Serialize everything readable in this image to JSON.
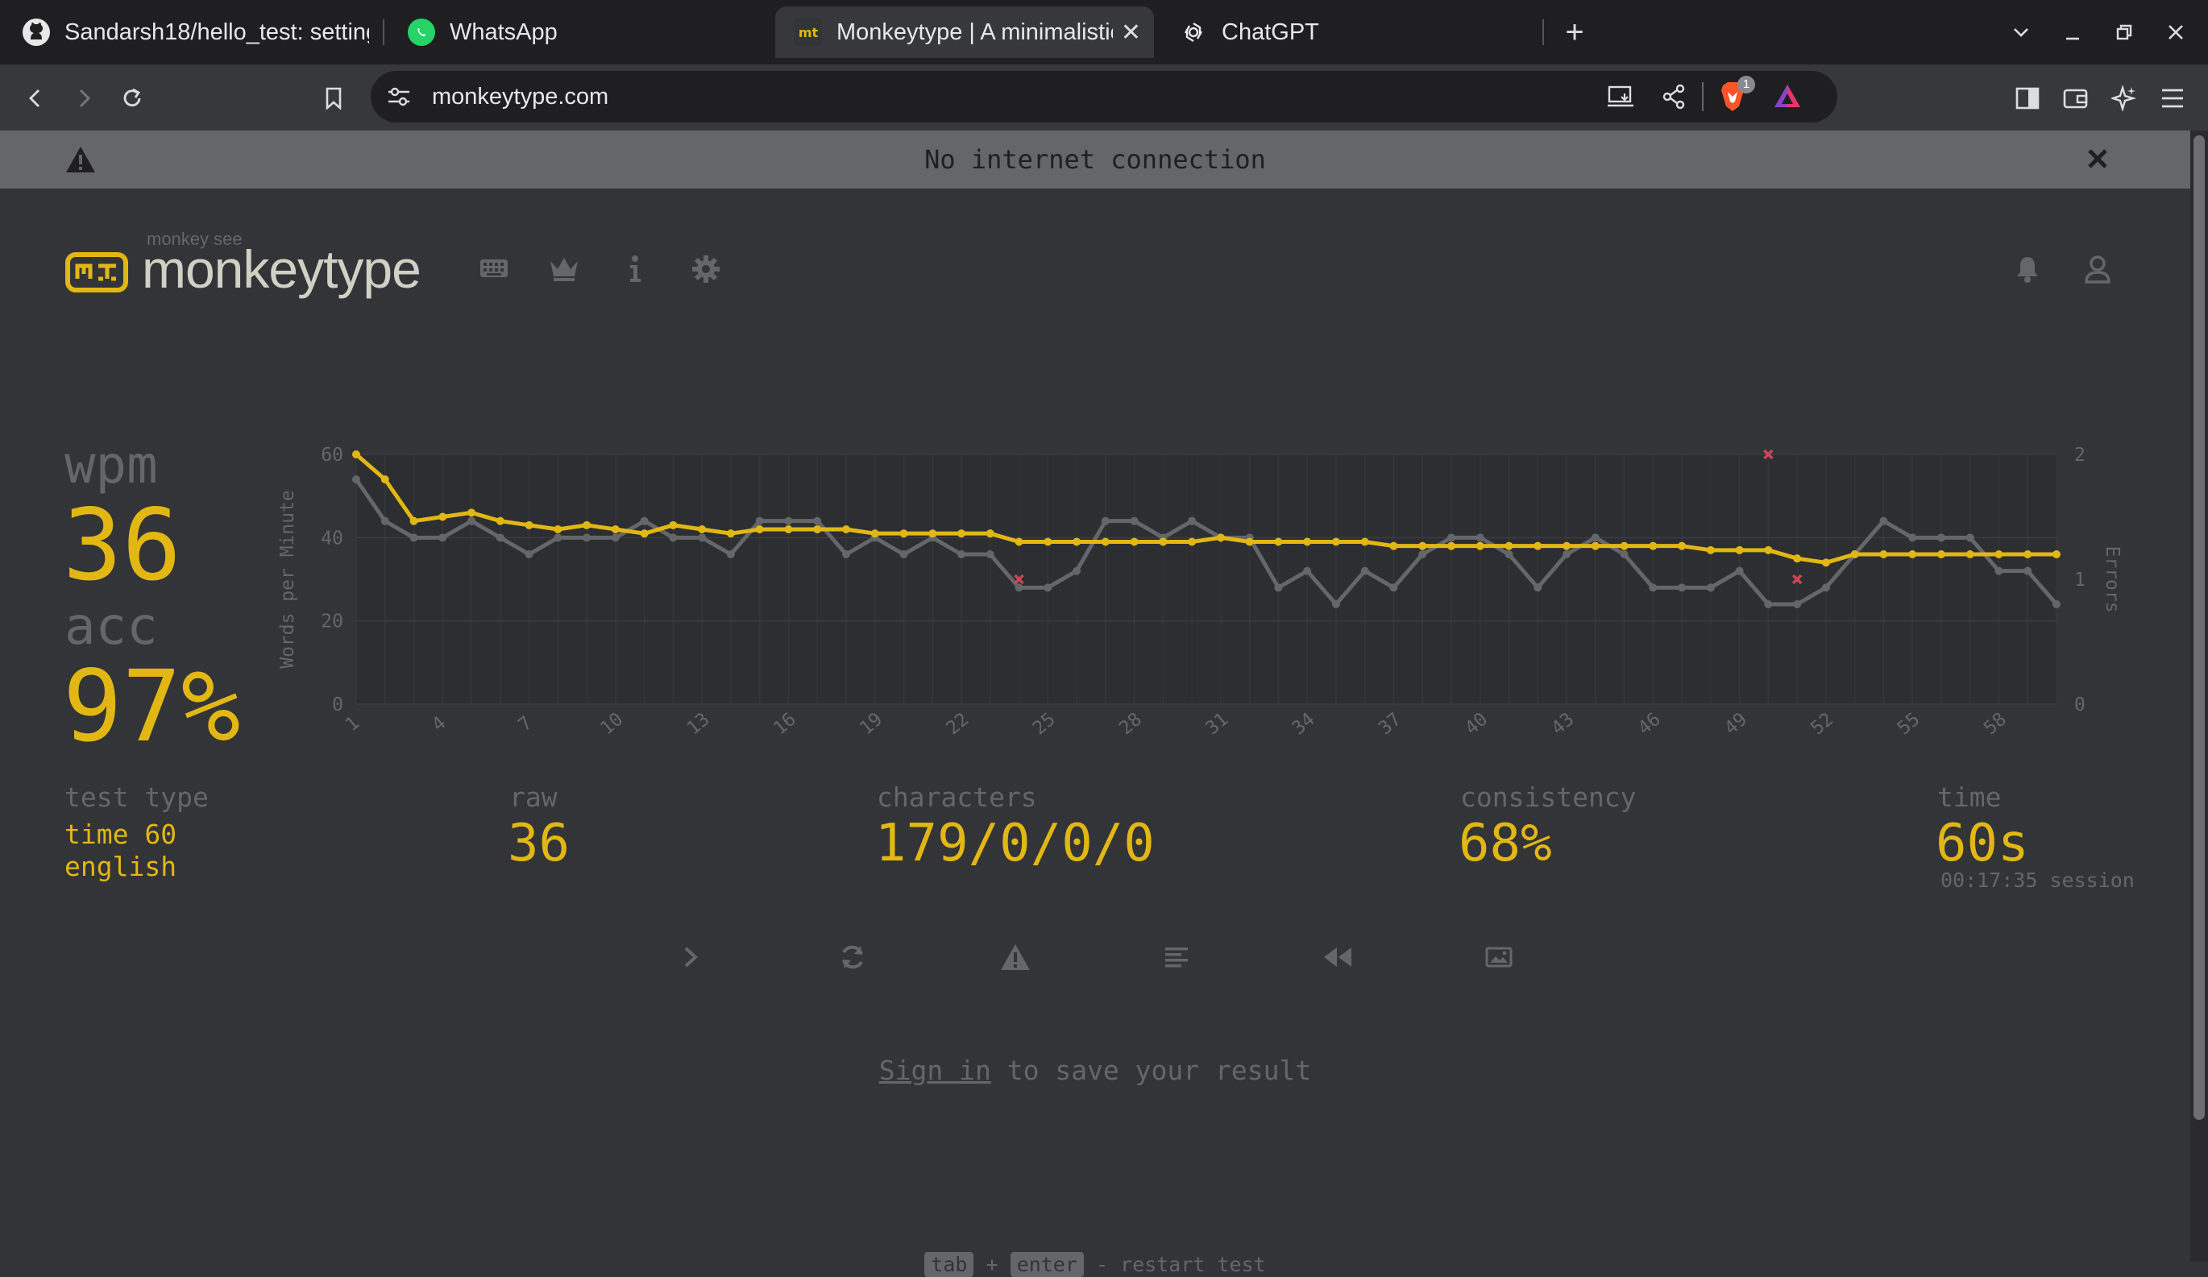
{
  "browser": {
    "tabs": [
      {
        "title": "Sandarsh18/hello_test: settings",
        "icon": "github-icon"
      },
      {
        "title": "WhatsApp",
        "icon": "whatsapp-icon"
      },
      {
        "title": "Monkeytype | A minimalistic typing test",
        "icon": "monkeytype-favicon",
        "favicon_text": "mt",
        "active": true
      },
      {
        "title": "ChatGPT",
        "icon": "chatgpt-icon"
      }
    ],
    "url": "monkeytype.com",
    "brave_badge": "1"
  },
  "banner": {
    "text": "No internet connection"
  },
  "header": {
    "logo_top": "monkey see",
    "logo_text": "monkeytype",
    "logo_mark": "mt",
    "nav_icons": [
      "keyboard-icon",
      "crown-icon",
      "info-icon",
      "settings-icon",
      "bell-icon",
      "user-icon"
    ]
  },
  "result": {
    "wpm_label": "wpm",
    "wpm": "36",
    "acc_label": "acc",
    "acc": "97%",
    "test_type_label": "test type",
    "test_type_1": "time 60",
    "test_type_2": "english",
    "raw_label": "raw",
    "raw": "36",
    "characters_label": "characters",
    "characters": "179/0/0/0",
    "consistency_label": "consistency",
    "consistency": "68%",
    "time_label": "time",
    "time": "60s",
    "session": "00:17:35 session"
  },
  "actions": [
    "next-test-icon",
    "restart-icon",
    "report-icon",
    "words-history-icon",
    "replay-icon",
    "screenshot-icon"
  ],
  "signin": {
    "link": "Sign in",
    "rest": " to save your result"
  },
  "footer": {
    "key1": "tab",
    "plus": "+",
    "key2": "enter",
    "text": " - restart test"
  },
  "colors": {
    "bg": "#323437",
    "main": "#e2b714",
    "sub": "#646669",
    "text": "#d1d0c5",
    "error": "#ca4754"
  },
  "chart_data": {
    "type": "line",
    "x": [
      1,
      2,
      3,
      4,
      5,
      6,
      7,
      8,
      9,
      10,
      11,
      12,
      13,
      14,
      15,
      16,
      17,
      18,
      19,
      20,
      21,
      22,
      23,
      24,
      25,
      26,
      27,
      28,
      29,
      30,
      31,
      32,
      33,
      34,
      35,
      36,
      37,
      38,
      39,
      40,
      41,
      42,
      43,
      44,
      45,
      46,
      47,
      48,
      49,
      50,
      51,
      52,
      53,
      54,
      55,
      56,
      57,
      58,
      59,
      60
    ],
    "x_ticks": [
      1,
      4,
      7,
      10,
      13,
      16,
      19,
      22,
      25,
      28,
      31,
      34,
      37,
      40,
      43,
      46,
      49,
      52,
      55,
      58
    ],
    "y_left_ticks": [
      0,
      20,
      40,
      60
    ],
    "y_right_ticks": [
      0,
      1,
      2
    ],
    "ylim": [
      0,
      60
    ],
    "y2lim": [
      0,
      2
    ],
    "ylabel": "Words per Minute",
    "y2label": "Errors",
    "series": [
      {
        "values": [
          60,
          54,
          44,
          45,
          46,
          44,
          43,
          42,
          43,
          42,
          41,
          43,
          42,
          41,
          42,
          42,
          42,
          42,
          41,
          41,
          41,
          41,
          41,
          39,
          39,
          39,
          39,
          39,
          39,
          39,
          40,
          39,
          39,
          39,
          39,
          39,
          38,
          38,
          38,
          38,
          38,
          38,
          38,
          38,
          38,
          38,
          38,
          37,
          37,
          37,
          35,
          34,
          36,
          36,
          36,
          36,
          36,
          36,
          36,
          36
        ],
        "color": "#e2b714"
      },
      {
        "values": [
          54,
          44,
          40,
          40,
          44,
          40,
          36,
          40,
          40,
          40,
          44,
          40,
          40,
          36,
          44,
          44,
          44,
          36,
          40,
          36,
          40,
          36,
          36,
          28,
          28,
          32,
          44,
          44,
          40,
          44,
          40,
          40,
          28,
          32,
          24,
          32,
          28,
          36,
          40,
          40,
          36,
          28,
          36,
          40,
          36,
          28,
          28,
          28,
          32,
          24,
          24,
          28,
          36,
          44,
          40,
          40,
          40,
          32,
          32,
          24
        ],
        "color": "#646669"
      }
    ],
    "errors": [
      {
        "x": 24,
        "y": 1
      },
      {
        "x": 50,
        "y": 2
      },
      {
        "x": 51,
        "y": 1
      }
    ]
  }
}
